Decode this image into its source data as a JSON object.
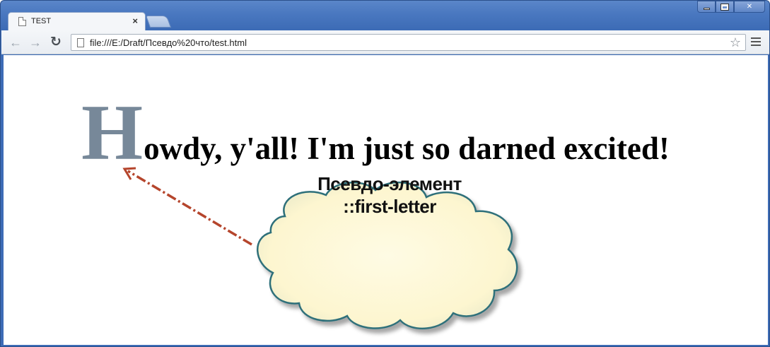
{
  "tab": {
    "title": "TEST",
    "close_glyph": "×"
  },
  "toolbar": {
    "back_glyph": "←",
    "forward_glyph": "→",
    "reload_glyph": "↻",
    "url": "file:///E:/Draft/Псевдо%20что/test.html",
    "star_glyph": "☆"
  },
  "page": {
    "first_letter": "H",
    "rest_text": "owdy, y'all! I'm just so darned excited!"
  },
  "callout": {
    "line1": "Псевдо-элемент",
    "line2": "::first-letter"
  },
  "colors": {
    "first_letter": "#778899",
    "cloud_fill": "#fdf8d8",
    "cloud_stroke": "#2f6f7a",
    "arrow": "#b5452c"
  },
  "icons": [
    "page-icon",
    "close-icon",
    "back-arrow-icon",
    "forward-arrow-icon",
    "reload-icon",
    "star-icon",
    "menu-icon",
    "minimize-icon",
    "maximize-icon",
    "window-close-icon"
  ]
}
